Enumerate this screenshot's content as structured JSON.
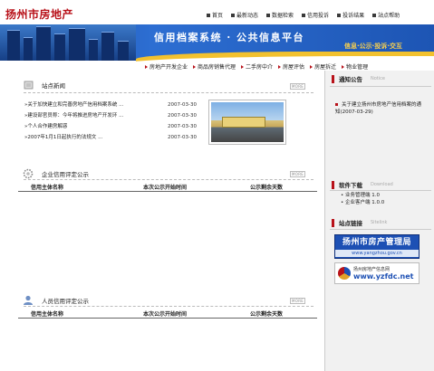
{
  "header": {
    "logo": "扬州市房地产",
    "top_nav": [
      "首页",
      "最新动态",
      "数据检索",
      "信用投诉",
      "投诉结果",
      "站点帮助"
    ],
    "slogan": "信用档案系统 · 公共信息平台",
    "motto": "信息·公示·投诉·交互"
  },
  "sub_nav": [
    "房地产开发企业",
    "商品房销售代理",
    "二手房中介",
    "房屋评估",
    "房屋拆迁",
    "物业管理"
  ],
  "site_news": {
    "title": "站点新闻",
    "more": "MORE",
    "items": [
      {
        "title": "»关于加快建立和完善房地产信用档案系统 ...",
        "date": "2007-03-30"
      },
      {
        "title": "»建设部官员称：今年将推进房地产开发环 ...",
        "date": "2007-03-30"
      },
      {
        "title": "»个人合作建房解惑",
        "date": "2007-03-30"
      },
      {
        "title": "»2007年1月1日起执行的法规文 ...",
        "date": "2007-03-30"
      }
    ]
  },
  "company_credit": {
    "title": "企业信用评定公示",
    "more": "MORE",
    "columns": [
      "信用主体名称",
      "本次公示开始时间",
      "公示剩余天数"
    ]
  },
  "personal_credit": {
    "title": "人员信用评定公示",
    "more": "MORE",
    "columns": [
      "信用主体名称",
      "本次公示开始时间",
      "公示剩余天数"
    ]
  },
  "sidebar": {
    "notice": {
      "title": "通知公告",
      "subtitle": "Notice",
      "text": "关于建立扬州市房地产信用档案的通知(2007-03-29)"
    },
    "downloads": {
      "title": "软件下载",
      "subtitle": "Download",
      "items": [
        "业务管理端 1.0",
        "企业客户端 1.0.0"
      ]
    },
    "links": {
      "title": "站点链接",
      "subtitle": "Sitelink",
      "link1_title": "扬州市房产管理局",
      "link1_url": "www.yangzhou.gov.cn",
      "link2_title": "扬州房地产信息网",
      "link2_url": "www.yzfdc.net"
    }
  },
  "colors": {
    "accent_red": "#b8121a",
    "banner_blue": "#1d50b4",
    "wave_yellow": "#f2c12e"
  }
}
